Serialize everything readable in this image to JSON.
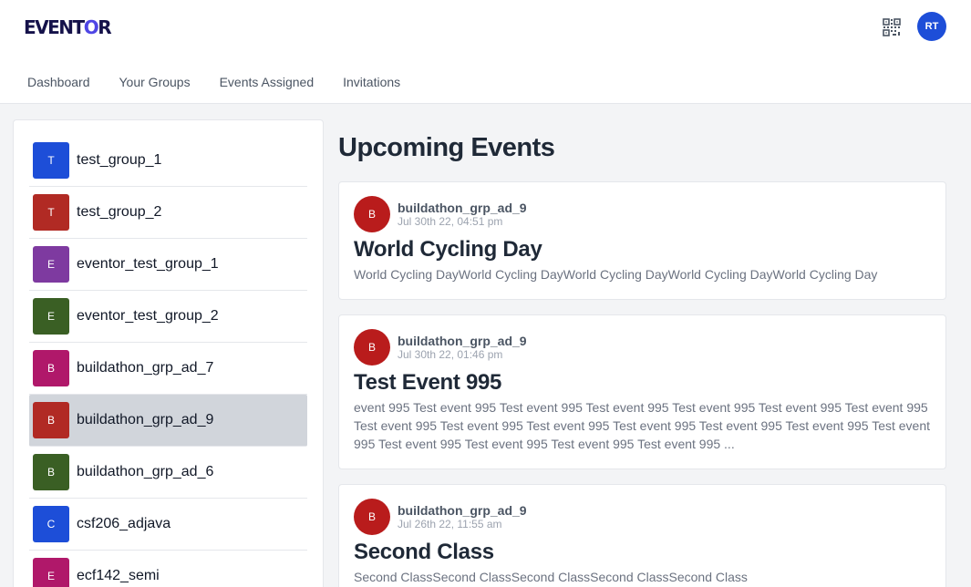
{
  "header": {
    "logo_prefix": "EVENT",
    "logo_o": "O",
    "logo_suffix": "R",
    "user_initials": "RT",
    "qr_icon": "qr-code-icon"
  },
  "nav": [
    "Dashboard",
    "Your Groups",
    "Events Assigned",
    "Invitations"
  ],
  "groups": [
    {
      "initial": "T",
      "name": "test_group_1",
      "color": "#1d4ed8"
    },
    {
      "initial": "T",
      "name": "test_group_2",
      "color": "#b12a24"
    },
    {
      "initial": "E",
      "name": "eventor_test_group_1",
      "color": "#7e3aa0"
    },
    {
      "initial": "E",
      "name": "eventor_test_group_2",
      "color": "#3a5f24"
    },
    {
      "initial": "B",
      "name": "buildathon_grp_ad_7",
      "color": "#b0186a"
    },
    {
      "initial": "B",
      "name": "buildathon_grp_ad_9",
      "color": "#b12a24",
      "active": true
    },
    {
      "initial": "B",
      "name": "buildathon_grp_ad_6",
      "color": "#3a5f24"
    },
    {
      "initial": "C",
      "name": "csf206_adjava",
      "color": "#1d4ed8"
    },
    {
      "initial": "E",
      "name": "ecf142_semi",
      "color": "#b0186a"
    }
  ],
  "main": {
    "title": "Upcoming Events",
    "events": [
      {
        "avatar": "B",
        "group": "buildathon_grp_ad_9",
        "time": "Jul 30th 22, 04:51 pm",
        "title": "World Cycling Day",
        "description": "World Cycling DayWorld Cycling DayWorld Cycling DayWorld Cycling DayWorld Cycling Day"
      },
      {
        "avatar": "B",
        "group": "buildathon_grp_ad_9",
        "time": "Jul 30th 22, 01:46 pm",
        "title": "Test Event 995",
        "description": "event 995 Test event 995 Test event 995 Test event 995 Test event 995 Test event 995 Test event 995 Test event 995 Test event 995 Test event 995 Test event 995 Test event 995 Test event 995 Test event 995 Test event 995 Test event 995 Test event 995 Test event 995 ..."
      },
      {
        "avatar": "B",
        "group": "buildathon_grp_ad_9",
        "time": "Jul 26th 22, 11:55 am",
        "title": "Second Class",
        "description": "Second ClassSecond ClassSecond ClassSecond ClassSecond Class"
      }
    ]
  }
}
